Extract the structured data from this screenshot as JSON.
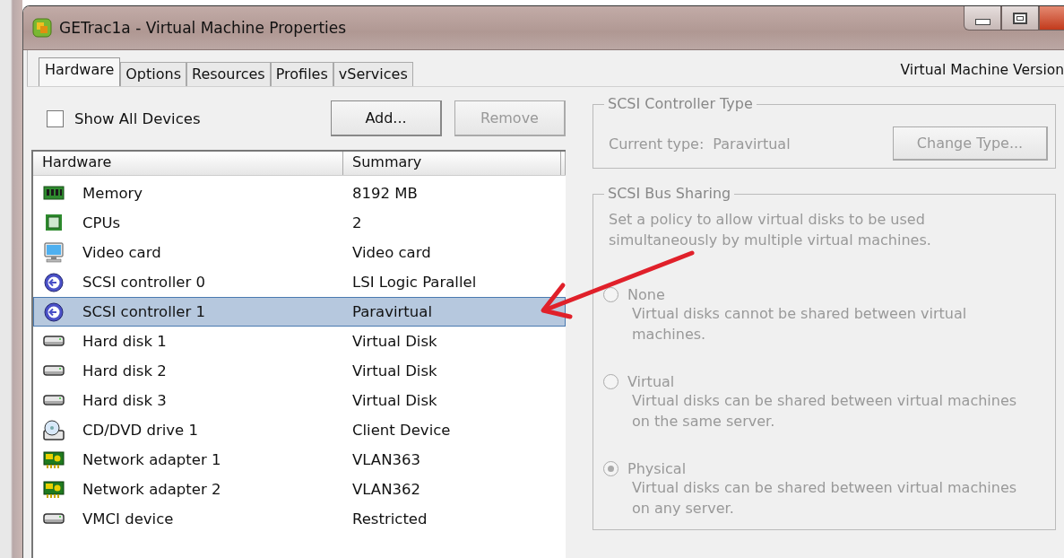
{
  "window": {
    "title": "GETrac1a - Virtual Machine Properties"
  },
  "tabs": [
    {
      "label": "Hardware",
      "selected": true
    },
    {
      "label": "Options",
      "selected": false
    },
    {
      "label": "Resources",
      "selected": false
    },
    {
      "label": "Profiles",
      "selected": false
    },
    {
      "label": "vServices",
      "selected": false
    }
  ],
  "version_label": "Virtual Machine Version",
  "show_all_devices": {
    "label": "Show All Devices",
    "checked": false
  },
  "buttons": [
    {
      "label": "Add...",
      "disabled": false
    },
    {
      "label": "Remove",
      "disabled": true
    }
  ],
  "table": {
    "columns": [
      "Hardware",
      "Summary"
    ],
    "rows": [
      {
        "kind": "memory",
        "name": "Memory",
        "summary": "8192 MB",
        "selected": false
      },
      {
        "kind": "cpu",
        "name": "CPUs",
        "summary": "2",
        "selected": false
      },
      {
        "kind": "video",
        "name": "Video card",
        "summary": "Video card",
        "selected": false
      },
      {
        "kind": "scsi",
        "name": "SCSI controller 0",
        "summary": "LSI Logic Parallel",
        "selected": false
      },
      {
        "kind": "scsi",
        "name": "SCSI controller 1",
        "summary": "Paravirtual",
        "selected": true
      },
      {
        "kind": "disk",
        "name": "Hard disk 1",
        "summary": "Virtual Disk",
        "selected": false
      },
      {
        "kind": "disk",
        "name": "Hard disk 2",
        "summary": "Virtual Disk",
        "selected": false
      },
      {
        "kind": "disk",
        "name": "Hard disk 3",
        "summary": "Virtual Disk",
        "selected": false
      },
      {
        "kind": "cdrom",
        "name": "CD/DVD drive 1",
        "summary": "Client Device",
        "selected": false
      },
      {
        "kind": "network",
        "name": "Network adapter 1",
        "summary": "VLAN363",
        "selected": false
      },
      {
        "kind": "network",
        "name": "Network adapter 2",
        "summary": "VLAN362",
        "selected": false
      },
      {
        "kind": "disk",
        "name": "VMCI device",
        "summary": "Restricted",
        "selected": false
      }
    ]
  },
  "controller_type": {
    "title": "SCSI Controller Type",
    "current_label": "Current type:",
    "current_value": "Paravirtual",
    "button": {
      "label": "Change Type...",
      "disabled": true
    }
  },
  "bus_sharing": {
    "title": "SCSI Bus Sharing",
    "description": "Set a policy to allow virtual disks to be used simultaneously by multiple virtual machines.",
    "disabled": true,
    "options": [
      {
        "label": "None",
        "description": "Virtual disks cannot be shared between virtual machines.",
        "selected": false
      },
      {
        "label": "Virtual",
        "description": "Virtual disks can be shared between virtual machines on the same server.",
        "selected": false
      },
      {
        "label": "Physical",
        "description": "Virtual disks can be shared between virtual machines on any server.",
        "selected": true
      }
    ]
  }
}
